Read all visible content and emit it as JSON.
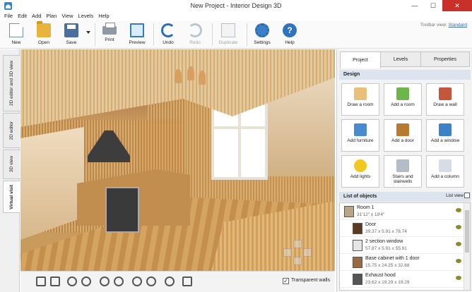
{
  "window": {
    "title": "New Project - Interior Design 3D",
    "minimize": "—",
    "maximize": "☐",
    "close": "✕"
  },
  "menu": [
    "File",
    "Edit",
    "Add",
    "Plan",
    "View",
    "Levels",
    "Help"
  ],
  "toolbar": {
    "new": "New",
    "open": "Open",
    "save": "Save",
    "print": "Print",
    "preview": "Preview",
    "undo": "Undo",
    "redo": "Redo",
    "duplicate": "Duplicate",
    "settings": "Settings",
    "help": "Help",
    "view_label": "Toolbar view:",
    "view_value": "Standard"
  },
  "vertical_tabs": [
    "2D editor and 3D view",
    "2D editor",
    "3D view",
    "Virtual visit"
  ],
  "active_vertical_tab": "Virtual visit",
  "viewport": {
    "transparent_walls_label": "Transparent walls",
    "transparent_walls_checked": true
  },
  "panel": {
    "tabs": [
      "Project",
      "Levels",
      "Properties"
    ],
    "active_tab": "Project",
    "design_header": "Design",
    "design_buttons": [
      {
        "label": "Draw a room",
        "icon": "draw-room-icon",
        "color": "#e8c07a"
      },
      {
        "label": "Add a room",
        "icon": "add-room-icon",
        "color": "#6db64a"
      },
      {
        "label": "Draw a wall",
        "icon": "draw-wall-icon",
        "color": "#c4563a"
      },
      {
        "label": "Add furniture",
        "icon": "chair-icon",
        "color": "#4a8ad0"
      },
      {
        "label": "Add a door",
        "icon": "door-icon",
        "color": "#b87a2e"
      },
      {
        "label": "Add a window",
        "icon": "window-icon",
        "color": "#3b82c9"
      },
      {
        "label": "Add lights",
        "icon": "bulb-icon",
        "color": "#f2c81e"
      },
      {
        "label": "Stairs and stairwells",
        "icon": "stairs-icon",
        "color": "#b4bcc6"
      },
      {
        "label": "Add a column",
        "icon": "column-icon",
        "color": "#d6dde6"
      }
    ],
    "objects_header": "List of objects",
    "list_view": "List view",
    "objects": [
      {
        "name": "Room 1",
        "dims": "31'12\" x 19'4\""
      },
      {
        "name": "Door",
        "dims": "39.37 x 5.91 x 78.74"
      },
      {
        "name": "2 section window",
        "dims": "57.87 x 5.91 x 55.91"
      },
      {
        "name": "Base cabinet with 1 door",
        "dims": "15.75 x 24.25 x 32.68"
      },
      {
        "name": "Exhaust hood",
        "dims": "23.62 x 19.29 x 19.29"
      }
    ]
  }
}
